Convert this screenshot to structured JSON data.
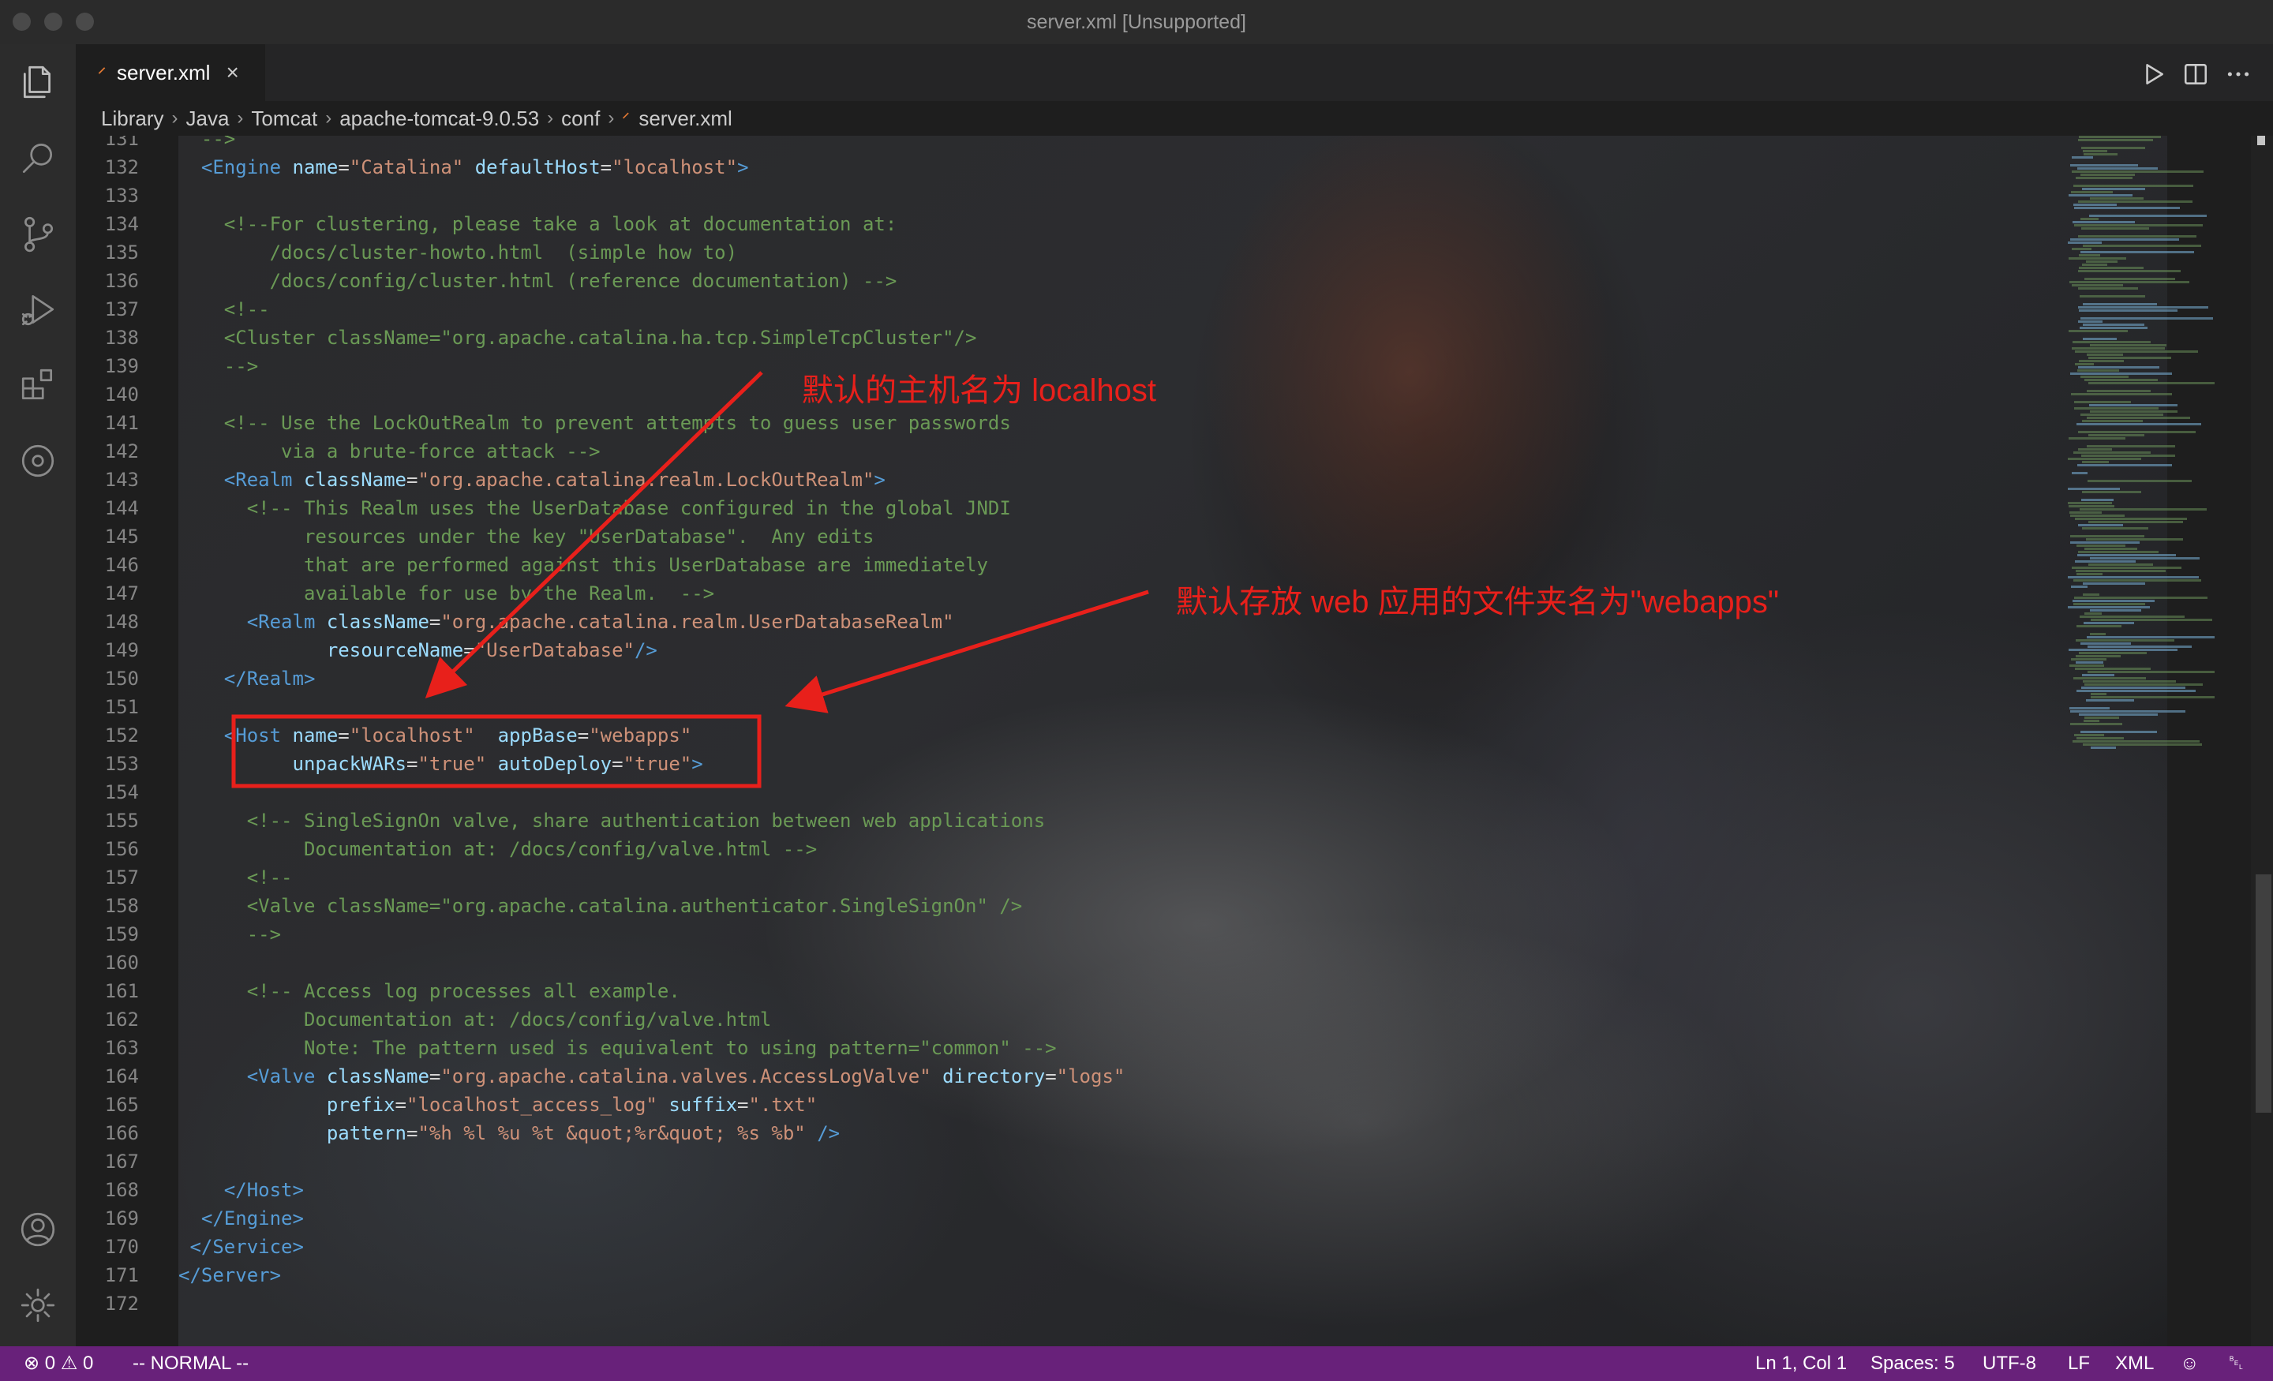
{
  "window": {
    "title": "server.xml [Unsupported]"
  },
  "tab": {
    "name": "server.xml",
    "close_glyph": "×"
  },
  "breadcrumb": [
    "Library",
    "Java",
    "Tomcat",
    "apache-tomcat-9.0.53",
    "conf",
    "server.xml"
  ],
  "activity_icons": [
    "explorer-icon",
    "search-icon",
    "source-control-icon",
    "run-debug-icon",
    "extensions-icon",
    "remote-icon",
    "account-icon",
    "settings-gear-icon"
  ],
  "editor_actions": [
    "run-icon",
    "split-editor-icon",
    "more-actions-icon"
  ],
  "lines": [
    {
      "n": "131",
      "segs": [
        [
          "c-com",
          "  -->"
        ]
      ]
    },
    {
      "n": "132",
      "segs": [
        [
          "c-txt",
          "  "
        ],
        [
          "c-tag",
          "<Engine"
        ],
        [
          "c-txt",
          " "
        ],
        [
          "c-attr",
          "name"
        ],
        [
          "c-txt",
          "="
        ],
        [
          "c-str",
          "\"Catalina\""
        ],
        [
          "c-txt",
          " "
        ],
        [
          "c-attr",
          "defaultHost"
        ],
        [
          "c-txt",
          "="
        ],
        [
          "c-str",
          "\"localhost\""
        ],
        [
          "c-tag",
          ">"
        ]
      ]
    },
    {
      "n": "133",
      "segs": [
        [
          "c-txt",
          ""
        ]
      ]
    },
    {
      "n": "134",
      "segs": [
        [
          "c-com",
          "    <!--For clustering, please take a look at documentation at:"
        ]
      ]
    },
    {
      "n": "135",
      "segs": [
        [
          "c-com",
          "        /docs/cluster-howto.html  (simple how to)"
        ]
      ]
    },
    {
      "n": "136",
      "segs": [
        [
          "c-com",
          "        /docs/config/cluster.html (reference documentation) -->"
        ]
      ]
    },
    {
      "n": "137",
      "segs": [
        [
          "c-com",
          "    <!--"
        ]
      ]
    },
    {
      "n": "138",
      "segs": [
        [
          "c-com",
          "    <Cluster className=\"org.apache.catalina.ha.tcp.SimpleTcpCluster\"/>"
        ]
      ]
    },
    {
      "n": "139",
      "segs": [
        [
          "c-com",
          "    -->"
        ]
      ]
    },
    {
      "n": "140",
      "segs": [
        [
          "c-txt",
          ""
        ]
      ]
    },
    {
      "n": "141",
      "segs": [
        [
          "c-com",
          "    <!-- Use the LockOutRealm to prevent attempts to guess user passwords"
        ]
      ]
    },
    {
      "n": "142",
      "segs": [
        [
          "c-com",
          "         via a brute-force attack -->"
        ]
      ]
    },
    {
      "n": "143",
      "segs": [
        [
          "c-txt",
          "    "
        ],
        [
          "c-tag",
          "<Realm"
        ],
        [
          "c-txt",
          " "
        ],
        [
          "c-attr",
          "className"
        ],
        [
          "c-txt",
          "="
        ],
        [
          "c-str",
          "\"org.apache.catalina.realm.LockOutRealm\""
        ],
        [
          "c-tag",
          ">"
        ]
      ]
    },
    {
      "n": "144",
      "segs": [
        [
          "c-com",
          "      <!-- This Realm uses the UserDatabase configured in the global JNDI"
        ]
      ]
    },
    {
      "n": "145",
      "segs": [
        [
          "c-com",
          "           resources under the key \"UserDatabase\".  Any edits"
        ]
      ]
    },
    {
      "n": "146",
      "segs": [
        [
          "c-com",
          "           that are performed against this UserDatabase are immediately"
        ]
      ]
    },
    {
      "n": "147",
      "segs": [
        [
          "c-com",
          "           available for use by the Realm.  -->"
        ]
      ]
    },
    {
      "n": "148",
      "segs": [
        [
          "c-txt",
          "      "
        ],
        [
          "c-tag",
          "<Realm"
        ],
        [
          "c-txt",
          " "
        ],
        [
          "c-attr",
          "className"
        ],
        [
          "c-txt",
          "="
        ],
        [
          "c-str",
          "\"org.apache.catalina.realm.UserDatabaseRealm\""
        ]
      ]
    },
    {
      "n": "149",
      "segs": [
        [
          "c-txt",
          "             "
        ],
        [
          "c-attr",
          "resourceName"
        ],
        [
          "c-txt",
          "="
        ],
        [
          "c-str",
          "\"UserDatabase\""
        ],
        [
          "c-tag",
          "/>"
        ]
      ]
    },
    {
      "n": "150",
      "segs": [
        [
          "c-txt",
          "    "
        ],
        [
          "c-tag",
          "</Realm>"
        ]
      ]
    },
    {
      "n": "151",
      "segs": [
        [
          "c-txt",
          ""
        ]
      ]
    },
    {
      "n": "152",
      "segs": [
        [
          "c-txt",
          "    "
        ],
        [
          "c-tag",
          "<Host"
        ],
        [
          "c-txt",
          " "
        ],
        [
          "c-attr",
          "name"
        ],
        [
          "c-txt",
          "="
        ],
        [
          "c-str",
          "\"localhost\""
        ],
        [
          "c-txt",
          "  "
        ],
        [
          "c-attr",
          "appBase"
        ],
        [
          "c-txt",
          "="
        ],
        [
          "c-str",
          "\"webapps\""
        ]
      ]
    },
    {
      "n": "153",
      "segs": [
        [
          "c-txt",
          "          "
        ],
        [
          "c-attr",
          "unpackWARs"
        ],
        [
          "c-txt",
          "="
        ],
        [
          "c-str",
          "\"true\""
        ],
        [
          "c-txt",
          " "
        ],
        [
          "c-attr",
          "autoDeploy"
        ],
        [
          "c-txt",
          "="
        ],
        [
          "c-str",
          "\"true\""
        ],
        [
          "c-tag",
          ">"
        ]
      ]
    },
    {
      "n": "154",
      "segs": [
        [
          "c-txt",
          ""
        ]
      ]
    },
    {
      "n": "155",
      "segs": [
        [
          "c-com",
          "      <!-- SingleSignOn valve, share authentication between web applications"
        ]
      ]
    },
    {
      "n": "156",
      "segs": [
        [
          "c-com",
          "           Documentation at: /docs/config/valve.html -->"
        ]
      ]
    },
    {
      "n": "157",
      "segs": [
        [
          "c-com",
          "      <!--"
        ]
      ]
    },
    {
      "n": "158",
      "segs": [
        [
          "c-com",
          "      <Valve className=\"org.apache.catalina.authenticator.SingleSignOn\" />"
        ]
      ]
    },
    {
      "n": "159",
      "segs": [
        [
          "c-com",
          "      -->"
        ]
      ]
    },
    {
      "n": "160",
      "segs": [
        [
          "c-txt",
          ""
        ]
      ]
    },
    {
      "n": "161",
      "segs": [
        [
          "c-com",
          "      <!-- Access log processes all example."
        ]
      ]
    },
    {
      "n": "162",
      "segs": [
        [
          "c-com",
          "           Documentation at: /docs/config/valve.html"
        ]
      ]
    },
    {
      "n": "163",
      "segs": [
        [
          "c-com",
          "           Note: The pattern used is equivalent to using pattern=\"common\" -->"
        ]
      ]
    },
    {
      "n": "164",
      "segs": [
        [
          "c-txt",
          "      "
        ],
        [
          "c-tag",
          "<Valve"
        ],
        [
          "c-txt",
          " "
        ],
        [
          "c-attr",
          "className"
        ],
        [
          "c-txt",
          "="
        ],
        [
          "c-str",
          "\"org.apache.catalina.valves.AccessLogValve\""
        ],
        [
          "c-txt",
          " "
        ],
        [
          "c-attr",
          "directory"
        ],
        [
          "c-txt",
          "="
        ],
        [
          "c-str",
          "\"logs\""
        ]
      ]
    },
    {
      "n": "165",
      "segs": [
        [
          "c-txt",
          "             "
        ],
        [
          "c-attr",
          "prefix"
        ],
        [
          "c-txt",
          "="
        ],
        [
          "c-str",
          "\"localhost_access_log\""
        ],
        [
          "c-txt",
          " "
        ],
        [
          "c-attr",
          "suffix"
        ],
        [
          "c-txt",
          "="
        ],
        [
          "c-str",
          "\".txt\""
        ]
      ]
    },
    {
      "n": "166",
      "segs": [
        [
          "c-txt",
          "             "
        ],
        [
          "c-attr",
          "pattern"
        ],
        [
          "c-txt",
          "="
        ],
        [
          "c-str",
          "\"%h %l %u %t &quot;%r&quot; %s %b\""
        ],
        [
          "c-txt",
          " "
        ],
        [
          "c-tag",
          "/>"
        ]
      ]
    },
    {
      "n": "167",
      "segs": [
        [
          "c-txt",
          ""
        ]
      ]
    },
    {
      "n": "168",
      "segs": [
        [
          "c-txt",
          "    "
        ],
        [
          "c-tag",
          "</Host>"
        ]
      ]
    },
    {
      "n": "169",
      "segs": [
        [
          "c-txt",
          "  "
        ],
        [
          "c-tag",
          "</Engine>"
        ]
      ]
    },
    {
      "n": "170",
      "segs": [
        [
          "c-txt",
          " "
        ],
        [
          "c-tag",
          "</Service>"
        ]
      ]
    },
    {
      "n": "171",
      "segs": [
        [
          "c-tag",
          "</Server>"
        ]
      ]
    },
    {
      "n": "172",
      "segs": [
        [
          "c-txt",
          ""
        ]
      ]
    }
  ],
  "annotations": {
    "label_host": "默认的主机名为 localhost",
    "label_appbase": "默认存放 web 应用的文件夹名为\"webapps\"",
    "color": "#e8201b"
  },
  "statusbar": {
    "errors": "0",
    "warnings": "0",
    "mode": "-- NORMAL --",
    "position": "Ln 1, Col 1",
    "spaces": "Spaces: 5",
    "encoding": "UTF-8",
    "eol": "LF",
    "language": "XML",
    "bg_color": "#68217a"
  }
}
